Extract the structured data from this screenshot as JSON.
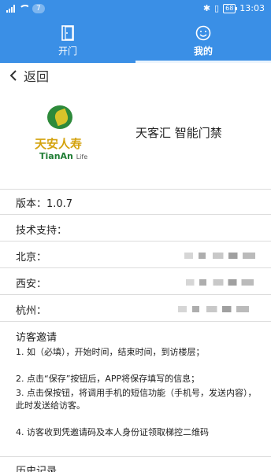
{
  "status_bar": {
    "badge": "7",
    "time": "13:03",
    "battery": "68"
  },
  "tabs": [
    {
      "label": "开门",
      "icon": "door-icon"
    },
    {
      "label": "我的",
      "icon": "smiley-icon"
    }
  ],
  "back": {
    "label": "返回"
  },
  "logo": {
    "cn": "天安人寿",
    "en": "TianAn",
    "en_suffix": "Life"
  },
  "app_title": "天客汇 智能门禁",
  "version": "版本：1.0.7",
  "support": "技术支持：",
  "contacts": [
    {
      "city": "北京："
    },
    {
      "city": "西安："
    },
    {
      "city": "杭州："
    }
  ],
  "invite": {
    "title": "访客邀请",
    "steps": [
      "1. 如（必填），开始时间，结束时间，到访楼层；",
      "2. 点击“保存”按钮后，APP将保存填写的信息；",
      "3. 点击保按钮，将调用手机的短信功能（手机号，发送内容），此时发送给访客。",
      "4. 访客收到凭邀请码及本人身份证领取梯控二维码"
    ]
  },
  "history_label": "历史记录"
}
